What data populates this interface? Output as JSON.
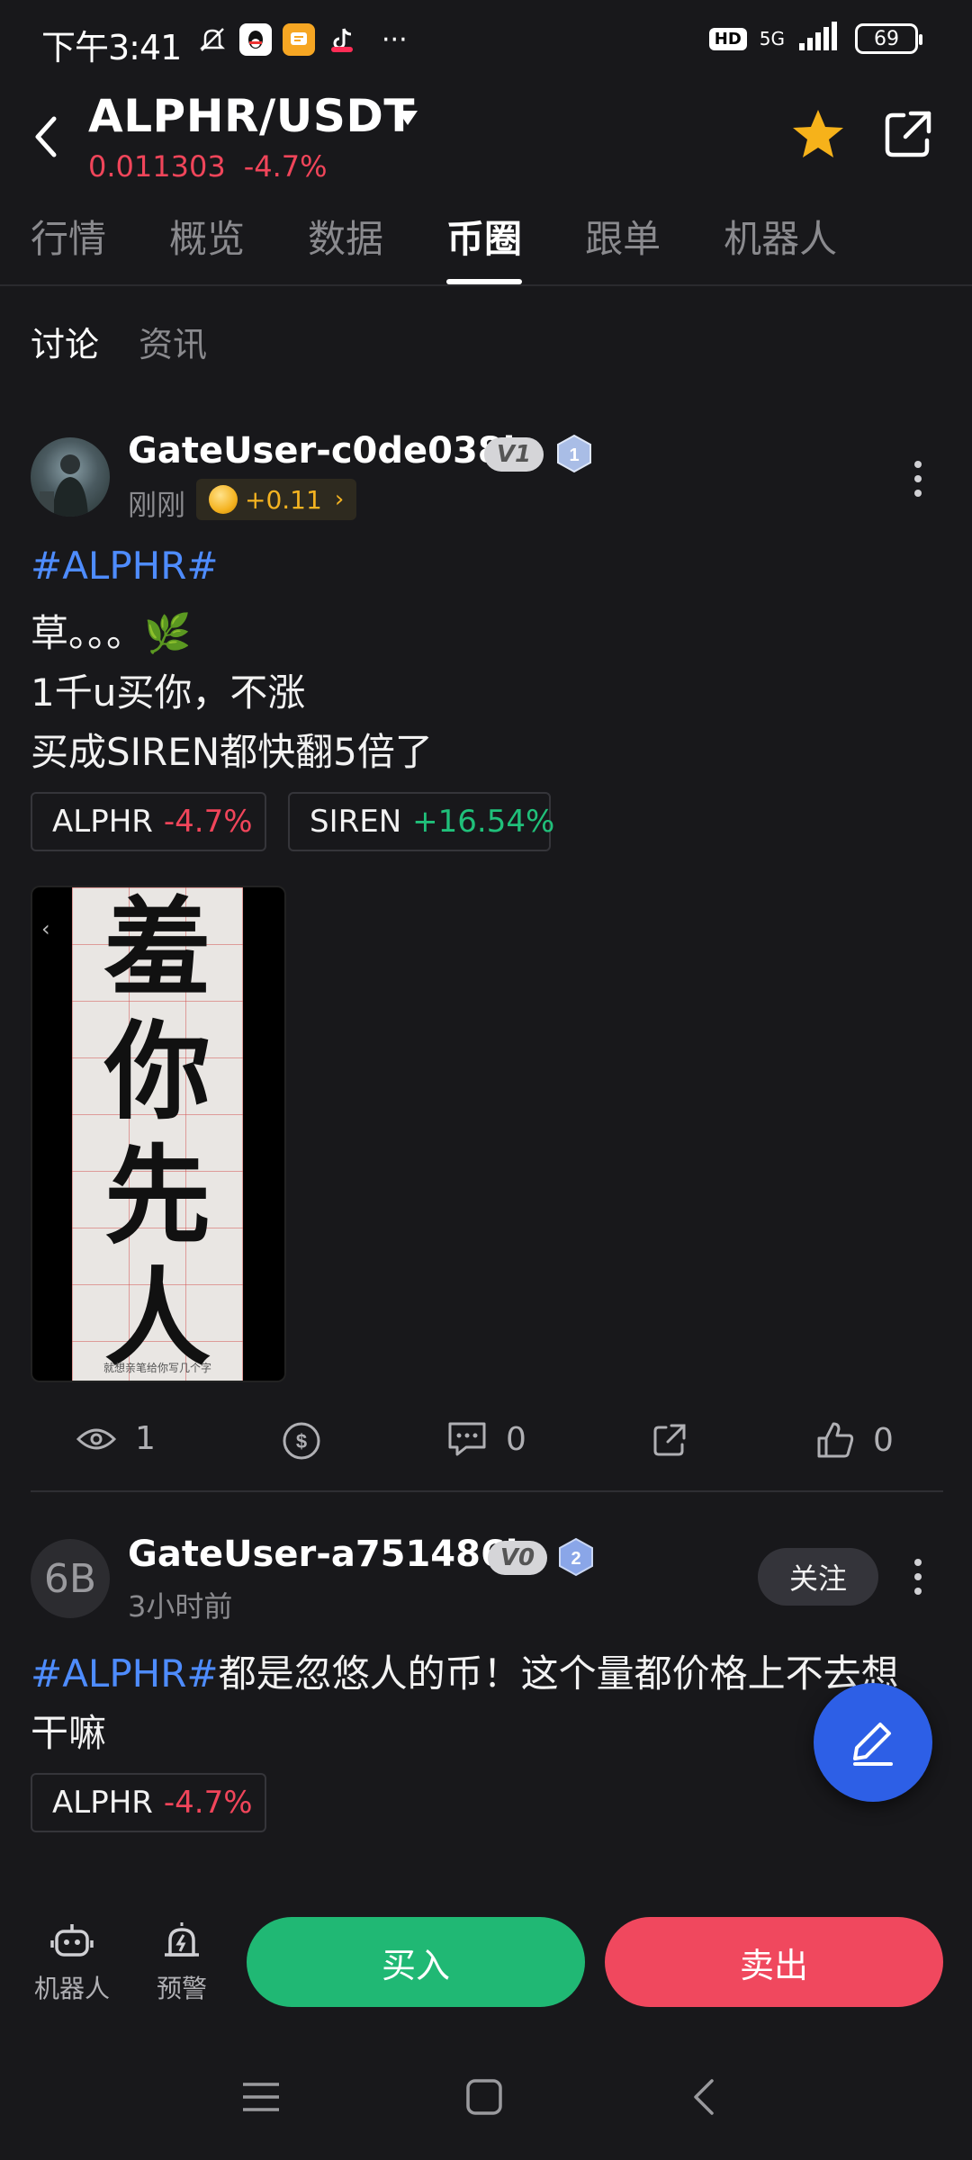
{
  "status_bar": {
    "time": "下午3:41",
    "network": "5G",
    "hd": "HD",
    "battery": "69",
    "more": "···"
  },
  "header": {
    "pair": "ALPHR/USDT",
    "price": "0.011303",
    "change": "-4.7%"
  },
  "tabs": [
    "行情",
    "概览",
    "数据",
    "币圈",
    "跟单",
    "机器人"
  ],
  "active_tab": "币圈",
  "subtabs": [
    "讨论",
    "资讯"
  ],
  "posts": [
    {
      "avatar": "",
      "username": "GateUser-c0de038b",
      "vip": "V1",
      "level": "1",
      "time": "刚刚",
      "tip": "+0.11",
      "lines": [
        "#ALPHR#",
        "草。。。🌿",
        "1千u买你，不涨",
        "买成SIREN都快翻5倍了"
      ],
      "chips": [
        {
          "symbol": "ALPHR",
          "change": "-4.7%"
        },
        {
          "symbol": "SIREN",
          "change": "+16.54%"
        }
      ],
      "image_text": [
        "羞",
        "你",
        "先",
        "人"
      ],
      "image_caption": "就想亲笔给你写几个字",
      "views": "1",
      "comments": "0",
      "likes": "0"
    },
    {
      "avatar": "6B",
      "username": "GateUser-a751486b",
      "vip": "V0",
      "level": "2",
      "time": "3小时前",
      "follow": "关注",
      "hashtag": "#ALPHR#",
      "text_line1": "都是忽悠人的币！这个量都价格上不去想",
      "text_line2": "干嘛",
      "chips": [
        {
          "symbol": "ALPHR",
          "change": "-4.7%"
        }
      ]
    }
  ],
  "bottom": {
    "robot": "机器人",
    "alert": "预警",
    "buy": "买入",
    "sell": "卖出"
  },
  "colors": {
    "background": "#18181b",
    "accent_blue": "#4e8cff",
    "down": "#f0455a",
    "up": "#20c07a",
    "buy": "#20b874",
    "sell": "#f0485e",
    "star": "#f6b21a"
  }
}
